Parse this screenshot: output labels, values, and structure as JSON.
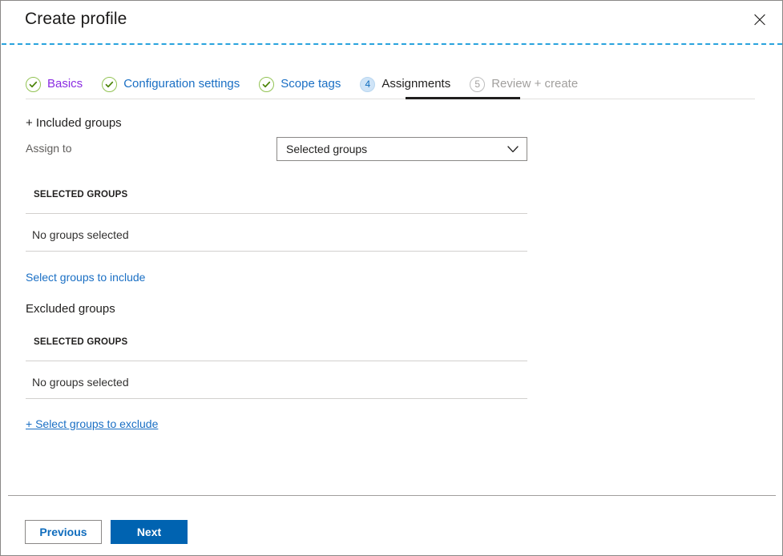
{
  "window": {
    "title": "Create profile",
    "close_icon": "close-icon",
    "accent_color": "#29a3dd",
    "border_color": "#8a8886"
  },
  "wizard": {
    "tabs": [
      {
        "label": "Basics",
        "badge": "✓",
        "state": "done",
        "icon": "check-circle-icon"
      },
      {
        "label": "Configuration settings",
        "badge": "✓",
        "state": "done",
        "icon": "check-circle-icon"
      },
      {
        "label": "Scope tags",
        "badge": "✓",
        "state": "done",
        "icon": "check-circle-icon"
      },
      {
        "label": "Assignments",
        "badge": "4",
        "state": "current",
        "icon": "step-number-badge"
      },
      {
        "label": "Review + create",
        "badge": "5",
        "state": "pending",
        "icon": "step-number-badge"
      }
    ],
    "current_step": 4,
    "total_steps": 5
  },
  "main": {
    "included": {
      "section_title": "+ Included groups",
      "assign_to_label": "Assign to",
      "assign_to_value": "Selected groups",
      "assign_to_options": [
        "Selected groups"
      ],
      "caret_icon": "chevron-down-icon",
      "column_header": "SELECTED GROUPS",
      "empty_text": "No groups selected",
      "link_label": "Select groups to include"
    },
    "excluded": {
      "section_title": "Excluded groups",
      "column_header": "SELECTED GROUPS",
      "empty_text": "No groups selected",
      "link_label": "+ Select groups to exclude"
    }
  },
  "footer": {
    "previous_label": "Previous",
    "next_label": "Next",
    "primary_color": "#0063b1",
    "link_color": "#1a6fc4"
  }
}
